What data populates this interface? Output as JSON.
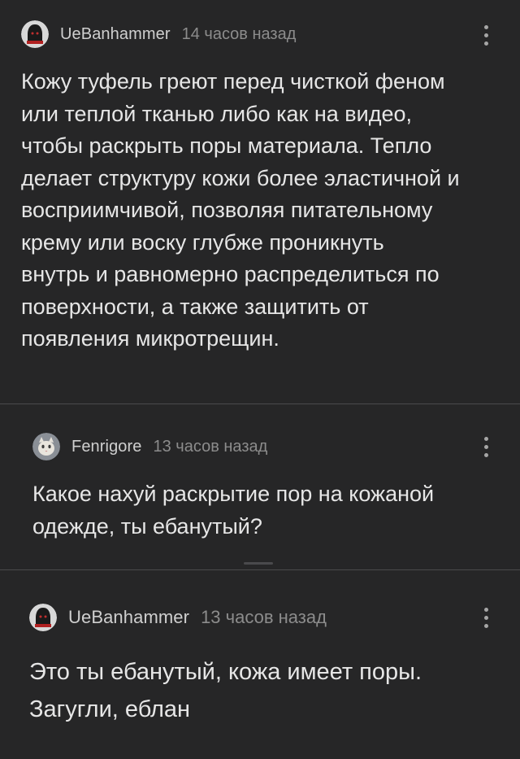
{
  "comments": [
    {
      "username": "UeBanhammer",
      "time": "14 часов назад",
      "text": "Кожу туфель греют перед чисткой феном\nили теплой тканью либо как на видео,\nчтобы раскрыть поры материала. Тепло\nделает структуру кожи более эластичной и\nвосприимчивой, позволяя питательному\nкрему или воску глубже проникнуть\nвнутрь и равномерно распределиться по\nповерхности, а также защитить от\nпоявления микротрещин.",
      "avatar_icon": "hooded-figure-icon"
    },
    {
      "username": "Fenrigore",
      "time": "13 часов назад",
      "text": "Какое нахуй раскрытие пор на кожаной\nодежде, ты ебанутый?",
      "avatar_icon": "cat-avatar-icon"
    },
    {
      "username": "UeBanhammer",
      "time": "13 часов назад",
      "text": "Это ты ебанутый, кожа имеет поры.\nЗагугли, еблан",
      "avatar_icon": "hooded-figure-icon"
    }
  ],
  "colors": {
    "background": "#262627",
    "text": "#e6e6e6",
    "username": "#cfcfcf",
    "timestamp": "#8c8c8c",
    "divider": "#4a4a4c"
  }
}
